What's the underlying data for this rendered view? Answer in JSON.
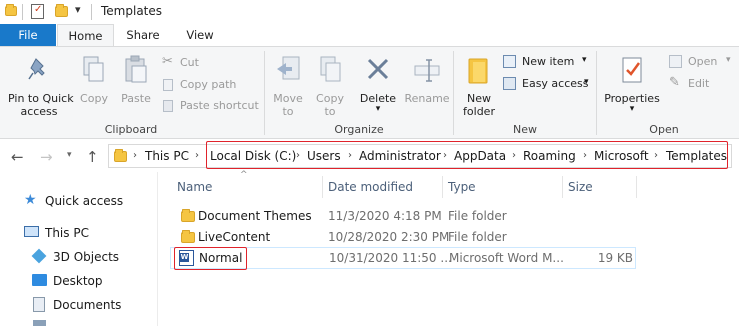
{
  "window": {
    "title": "Templates"
  },
  "tabs": [
    {
      "label": "File"
    },
    {
      "label": "Home"
    },
    {
      "label": "Share"
    },
    {
      "label": "View"
    }
  ],
  "ribbon": {
    "clipboard": {
      "group_label": "Clipboard",
      "pin_line1": "Pin to Quick",
      "pin_line2": "access",
      "copy": "Copy",
      "paste": "Paste",
      "cut": "Cut",
      "copy_path": "Copy path",
      "paste_shortcut": "Paste shortcut"
    },
    "organize": {
      "group_label": "Organize",
      "move_to_line1": "Move",
      "move_to_line2": "to",
      "copy_to_line1": "Copy",
      "copy_to_line2": "to",
      "delete": "Delete",
      "rename": "Rename"
    },
    "new": {
      "group_label": "New",
      "new_folder_line1": "New",
      "new_folder_line2": "folder",
      "new_item": "New item",
      "easy_access": "Easy access"
    },
    "open": {
      "group_label": "Open",
      "properties": "Properties",
      "open": "Open",
      "edit": "Edit"
    }
  },
  "address": {
    "crumbs": [
      "This PC",
      "Local Disk (C:)",
      "Users",
      "Administrator",
      "AppData",
      "Roaming",
      "Microsoft",
      "Templates"
    ]
  },
  "nav_pane": {
    "items": [
      {
        "label": "Quick access",
        "icon": "star-icon"
      },
      {
        "label": "This PC",
        "icon": "computer-icon"
      },
      {
        "label": "3D Objects",
        "icon": "cube-icon"
      },
      {
        "label": "Desktop",
        "icon": "desktop-icon"
      },
      {
        "label": "Documents",
        "icon": "documents-icon"
      }
    ]
  },
  "columns": {
    "name": "Name",
    "date": "Date modified",
    "type": "Type",
    "size": "Size"
  },
  "files": [
    {
      "name": "Document Themes",
      "date": "11/3/2020 4:18 PM",
      "type": "File folder",
      "size": "",
      "icon": "folder-icon"
    },
    {
      "name": "LiveContent",
      "date": "10/28/2020 2:30 PM",
      "type": "File folder",
      "size": "",
      "icon": "folder-icon"
    },
    {
      "name": "Normal",
      "date": "10/31/2020 11:50 ...",
      "type": "Microsoft Word M...",
      "size": "19 KB",
      "icon": "word-document-icon"
    }
  ],
  "colors": {
    "accent": "#1979ca",
    "highlight": "#e0232b",
    "folder": "#f5c542",
    "selection": "#e5f3ff"
  }
}
